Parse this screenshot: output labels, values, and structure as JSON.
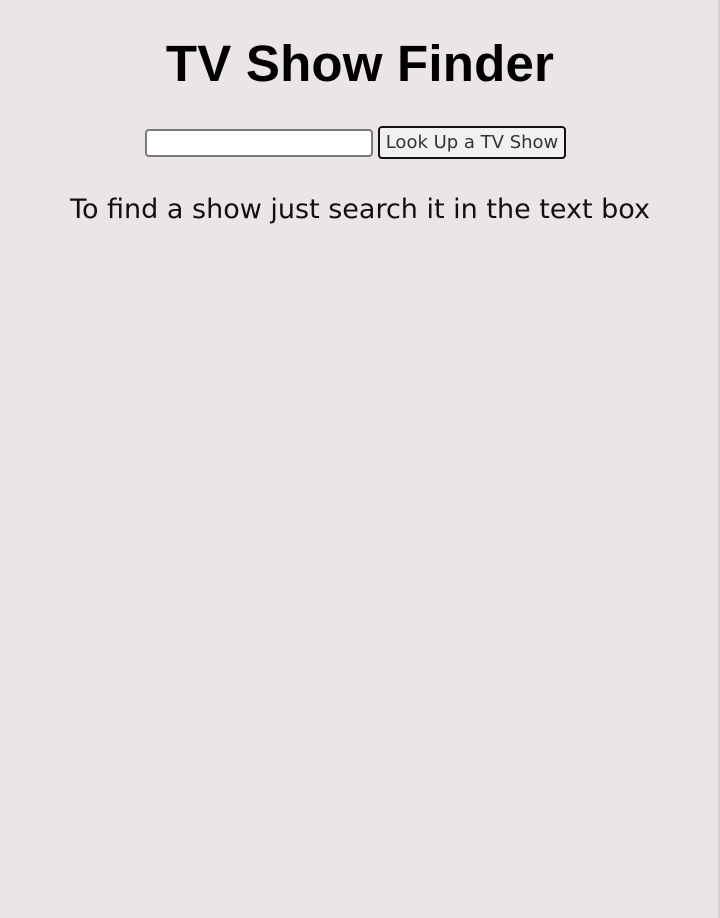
{
  "page": {
    "background_color": "#ebe5e5"
  },
  "header": {
    "title": "TV Show Finder"
  },
  "search": {
    "value": "",
    "placeholder": "",
    "button_label": "Look Up a TV Show"
  },
  "main": {
    "instructions": "To find a show just search it in the text box"
  }
}
